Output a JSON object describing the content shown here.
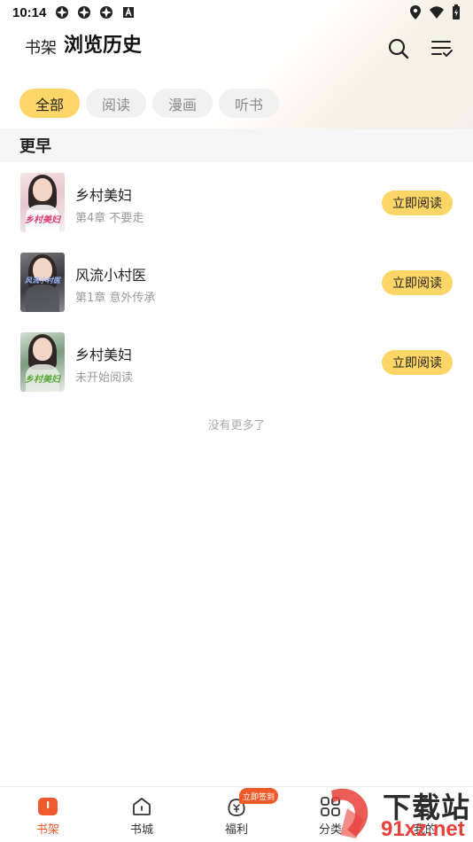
{
  "status_bar": {
    "time": "10:14"
  },
  "header": {
    "crumb": "书架",
    "title": "浏览历史"
  },
  "filters": [
    {
      "label": "全部",
      "active": true
    },
    {
      "label": "阅读",
      "active": false
    },
    {
      "label": "漫画",
      "active": false
    },
    {
      "label": "听书",
      "active": false
    }
  ],
  "section": {
    "title": "更早"
  },
  "books": [
    {
      "title": "乡村美妇",
      "progress": "第4章 不要走",
      "cover_text": "乡村美妇",
      "button": "立即阅读"
    },
    {
      "title": "风流小村医",
      "progress": "第1章 意外传承",
      "cover_text": "风流小村医",
      "button": "立即阅读"
    },
    {
      "title": "乡村美妇",
      "progress": "未开始阅读",
      "cover_text": "乡村美妇",
      "button": "立即阅读"
    }
  ],
  "list_end": "没有更多了",
  "tabbar": {
    "items": [
      {
        "label": "书架",
        "icon": "bookshelf-icon",
        "active": true
      },
      {
        "label": "书城",
        "icon": "bookstore-icon",
        "active": false
      },
      {
        "label": "福利",
        "icon": "welfare-icon",
        "active": false
      },
      {
        "label": "分类",
        "icon": "category-icon",
        "active": false
      },
      {
        "label": "我的",
        "icon": "profile-icon",
        "active": false
      }
    ],
    "badge": "立即签到"
  },
  "watermark": {
    "line1": "下载站",
    "line2": "91xz.net"
  },
  "colors": {
    "accent": "#fdd667",
    "active_tab": "#ee5a2e",
    "badge": "#f05a28"
  }
}
